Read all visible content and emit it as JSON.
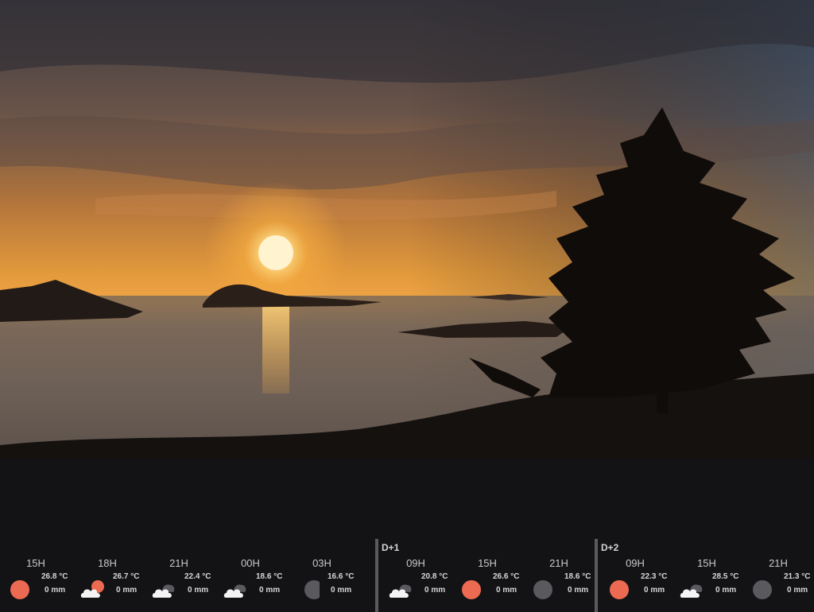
{
  "background": {
    "alt": "Sunset over a bay with islands and a tree silhouette"
  },
  "colors": {
    "sun": "#ec6a52",
    "night": "#5a5a5e",
    "cloud": "#f4f4f4",
    "panel": "#131316"
  },
  "days": [
    {
      "label": "",
      "slots": [
        {
          "time": "15H",
          "temp": "26.8 °C",
          "rain": "0 mm",
          "icon": "sun-icon"
        },
        {
          "time": "18H",
          "temp": "26.7 °C",
          "rain": "0 mm",
          "icon": "sun-cloud-icon"
        },
        {
          "time": "21H",
          "temp": "22.4 °C",
          "rain": "0 mm",
          "icon": "night-cloud-icon"
        },
        {
          "time": "00H",
          "temp": "18.6 °C",
          "rain": "0 mm",
          "icon": "night-cloud-icon"
        },
        {
          "time": "03H",
          "temp": "16.6 °C",
          "rain": "0 mm",
          "icon": "moon-icon"
        }
      ]
    },
    {
      "label": "D+1",
      "slots": [
        {
          "time": "09H",
          "temp": "20.8 °C",
          "rain": "0 mm",
          "icon": "night-cloud-icon"
        },
        {
          "time": "15H",
          "temp": "26.6 °C",
          "rain": "0 mm",
          "icon": "sun-icon"
        },
        {
          "time": "21H",
          "temp": "18.6 °C",
          "rain": "0 mm",
          "icon": "moon-icon"
        }
      ]
    },
    {
      "label": "D+2",
      "slots": [
        {
          "time": "09H",
          "temp": "22.3 °C",
          "rain": "0 mm",
          "icon": "sun-icon"
        },
        {
          "time": "15H",
          "temp": "28.5 °C",
          "rain": "0 mm",
          "icon": "night-cloud-icon"
        },
        {
          "time": "21H",
          "temp": "21.3 °C",
          "rain": "0 mm",
          "icon": "moon-icon"
        }
      ]
    }
  ]
}
